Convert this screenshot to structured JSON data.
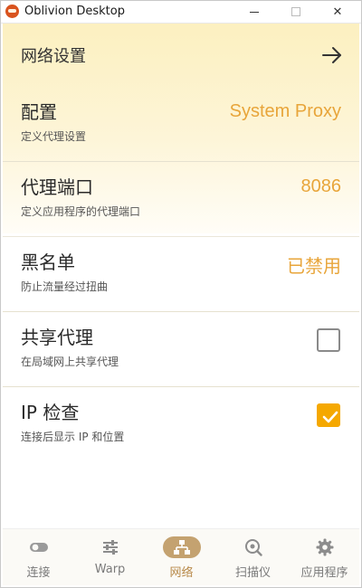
{
  "window": {
    "title": "Oblivion Desktop",
    "minimize_glyph": "",
    "close_glyph": "✕"
  },
  "header": {
    "title": "网络设置",
    "arrow_icon": "arrow-right-icon"
  },
  "settings": [
    {
      "label": "配置",
      "description": "定义代理设置",
      "value": "System Proxy"
    },
    {
      "label": "代理端口",
      "description": "定义应用程序的代理端口",
      "value": "8086"
    },
    {
      "label": "黑名单",
      "description": "防止流量经过扭曲",
      "value": "已禁用"
    },
    {
      "label": "共享代理",
      "description": "在局域网上共享代理",
      "checked": false
    },
    {
      "label": "IP 检查",
      "description": "连接后显示 IP 和位置",
      "checked": true
    }
  ],
  "nav": {
    "items": [
      {
        "label": "连接",
        "icon": "toggle-icon",
        "active": false
      },
      {
        "label": "Warp",
        "icon": "sliders-icon",
        "active": false
      },
      {
        "label": "网络",
        "icon": "network-icon",
        "active": true
      },
      {
        "label": "扫描仪",
        "icon": "scanner-icon",
        "active": false
      },
      {
        "label": "应用程序",
        "icon": "gear-icon",
        "active": false
      }
    ]
  },
  "colors": {
    "accent": "#e8a53a",
    "checkbox_checked": "#f5a800",
    "active_nav_pill": "#c4a270",
    "header_gradient_top": "#fcf0c0"
  }
}
